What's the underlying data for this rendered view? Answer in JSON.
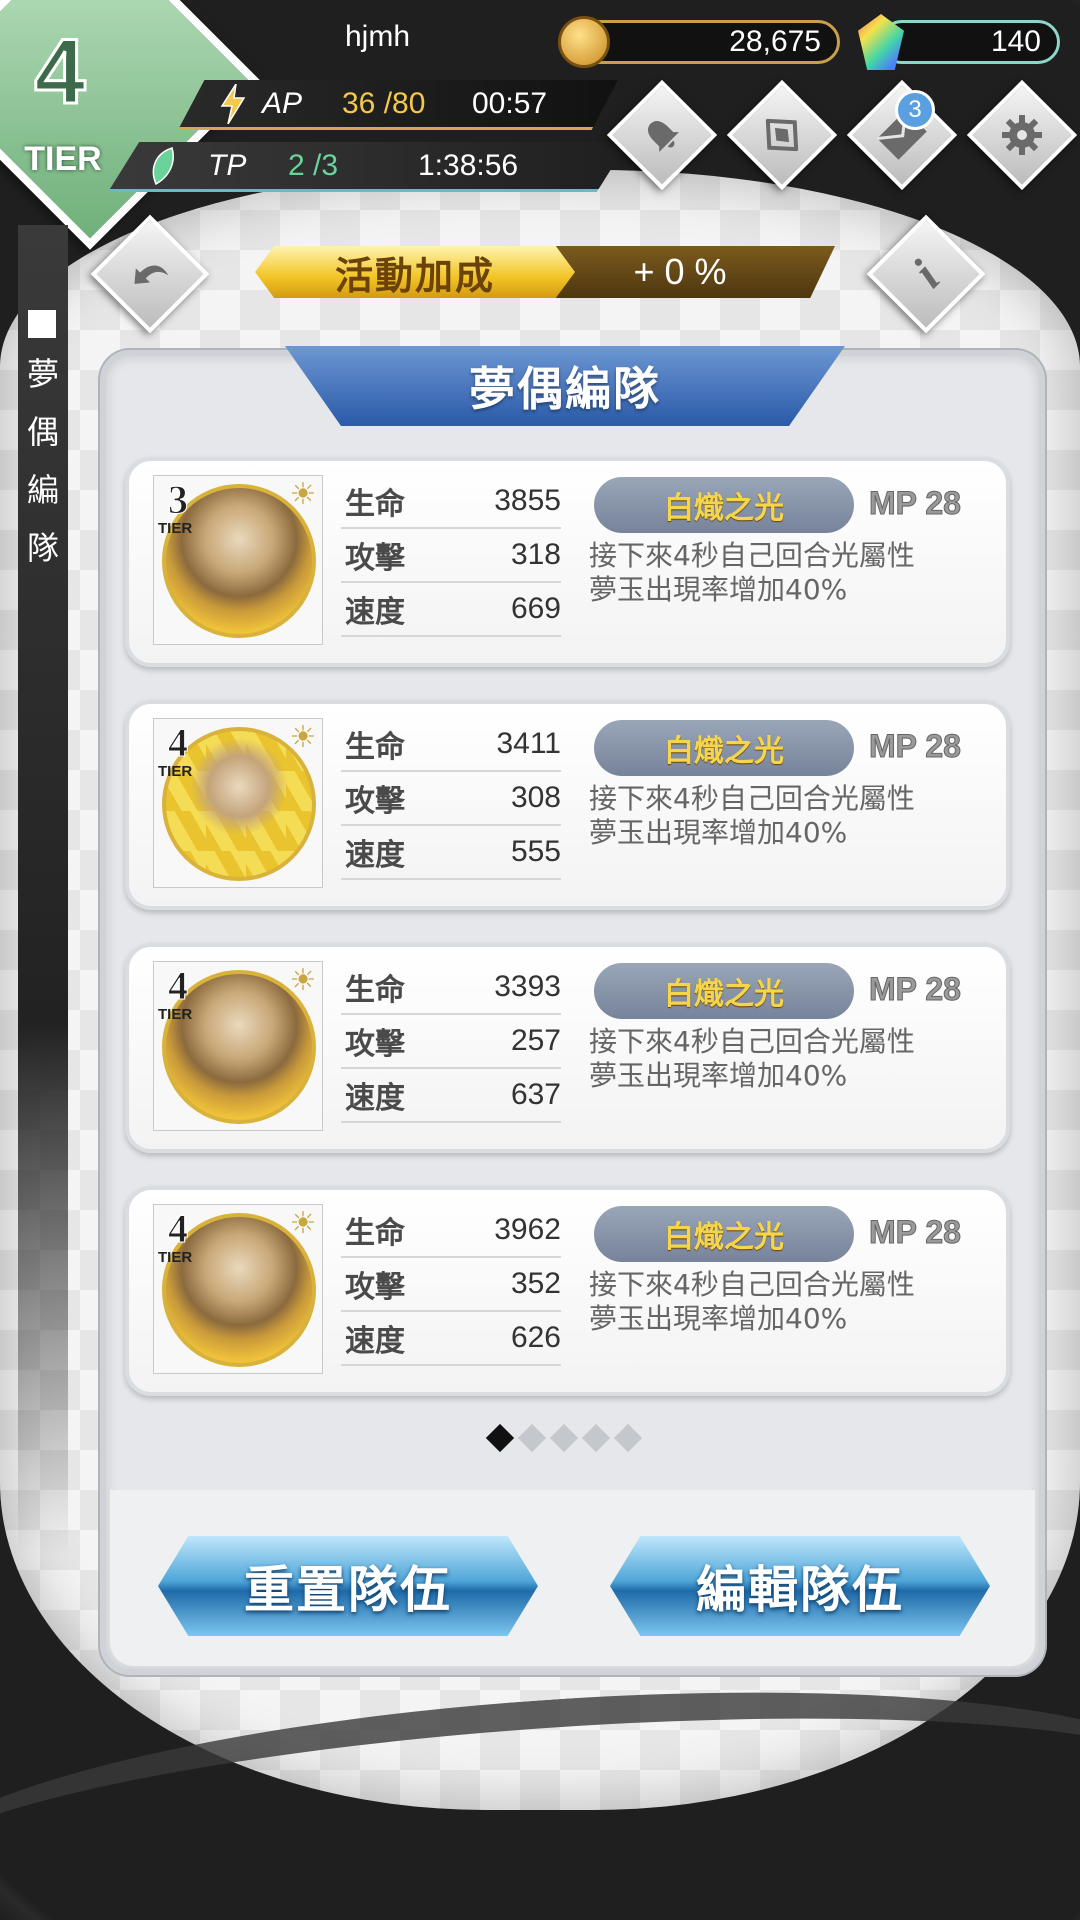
{
  "header": {
    "tier_number": "4",
    "tier_label": "TIER",
    "username": "hjmh",
    "gold": "28,675",
    "gems": "140",
    "ap_label": "AP",
    "ap_value": "36 /80",
    "ap_timer": "00:57",
    "tp_label": "TP",
    "tp_value": "2 /3",
    "tp_timer": "1:38:56",
    "mail_badge": "3",
    "icons": [
      "bell-icon",
      "crystal-icon",
      "mail-icon",
      "gear-icon"
    ]
  },
  "side_label": "夢偶編隊",
  "bonus": {
    "label": "活動加成",
    "value": "+ 0 %"
  },
  "panel": {
    "title": "夢偶編隊"
  },
  "stat_labels": {
    "hp": "生命",
    "atk": "攻擊",
    "spd": "速度"
  },
  "cards": [
    {
      "tier": "3",
      "tier_label": "TIER",
      "hp": "3855",
      "atk": "318",
      "spd": "669",
      "skill": "白熾之光",
      "mp": "MP 28",
      "desc_line1": "接下來4秒自己回合光屬性",
      "desc_line2": "夢玉出現率增加40%"
    },
    {
      "tier": "4",
      "tier_label": "TIER",
      "hp": "3411",
      "atk": "308",
      "spd": "555",
      "skill": "白熾之光",
      "mp": "MP 28",
      "desc_line1": "接下來4秒自己回合光屬性",
      "desc_line2": "夢玉出現率增加40%"
    },
    {
      "tier": "4",
      "tier_label": "TIER",
      "hp": "3393",
      "atk": "257",
      "spd": "637",
      "skill": "白熾之光",
      "mp": "MP 28",
      "desc_line1": "接下來4秒自己回合光屬性",
      "desc_line2": "夢玉出現率增加40%"
    },
    {
      "tier": "4",
      "tier_label": "TIER",
      "hp": "3962",
      "atk": "352",
      "spd": "626",
      "skill": "白熾之光",
      "mp": "MP 28",
      "desc_line1": "接下來4秒自己回合光屬性",
      "desc_line2": "夢玉出現率增加40%"
    }
  ],
  "pager": {
    "current_page": 1,
    "total_pages": 5
  },
  "buttons": {
    "reset": "重置隊伍",
    "edit": "編輯隊伍"
  }
}
